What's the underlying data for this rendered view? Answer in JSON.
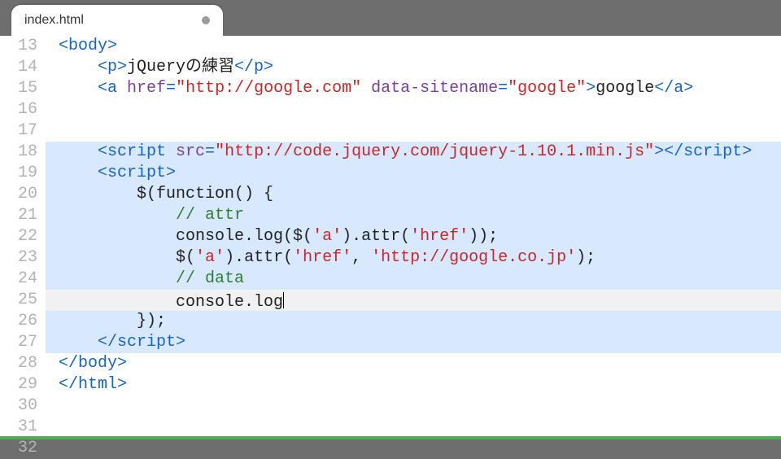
{
  "tab": {
    "filename": "index.html",
    "dirty": true
  },
  "gutter_start": 13,
  "gutter_end": 32,
  "current_line": 25,
  "selection_lines": [
    18,
    19,
    20,
    21,
    22,
    23,
    24,
    25,
    26,
    27
  ],
  "code_lines": {
    "13": [
      {
        "cls": "tag",
        "t": "<body>"
      }
    ],
    "14": [
      {
        "cls": "pun",
        "t": "    "
      },
      {
        "cls": "tag",
        "t": "<p>"
      },
      {
        "cls": "txt",
        "t": "jQueryの練習"
      },
      {
        "cls": "tag",
        "t": "</p>"
      }
    ],
    "15": [
      {
        "cls": "pun",
        "t": "    "
      },
      {
        "cls": "tag",
        "t": "<a "
      },
      {
        "cls": "attr",
        "t": "href"
      },
      {
        "cls": "tag",
        "t": "="
      },
      {
        "cls": "str",
        "t": "\"http://google.com\""
      },
      {
        "cls": "tag",
        "t": " "
      },
      {
        "cls": "attr",
        "t": "data-sitename"
      },
      {
        "cls": "tag",
        "t": "="
      },
      {
        "cls": "str",
        "t": "\"google\""
      },
      {
        "cls": "tag",
        "t": ">"
      },
      {
        "cls": "txt",
        "t": "google"
      },
      {
        "cls": "tag",
        "t": "</a>"
      }
    ],
    "16": [
      {
        "cls": "pun",
        "t": ""
      }
    ],
    "17": [
      {
        "cls": "pun",
        "t": ""
      }
    ],
    "18": [
      {
        "cls": "pun",
        "t": "    "
      },
      {
        "cls": "tag",
        "t": "<script "
      },
      {
        "cls": "attr",
        "t": "src"
      },
      {
        "cls": "tag",
        "t": "="
      },
      {
        "cls": "str",
        "t": "\"http://code.jquery.com/jquery-1.10.1.min.js\""
      },
      {
        "cls": "tag",
        "t": ">"
      },
      {
        "cls": "tag",
        "t": "</script>"
      }
    ],
    "19": [
      {
        "cls": "pun",
        "t": "    "
      },
      {
        "cls": "tag",
        "t": "<script>"
      }
    ],
    "20": [
      {
        "cls": "pun",
        "t": "        "
      },
      {
        "cls": "txt",
        "t": "$(function() {"
      }
    ],
    "21": [
      {
        "cls": "pun",
        "t": "            "
      },
      {
        "cls": "com",
        "t": "// attr"
      }
    ],
    "22": [
      {
        "cls": "pun",
        "t": "            "
      },
      {
        "cls": "txt",
        "t": "console.log($("
      },
      {
        "cls": "str",
        "t": "'a'"
      },
      {
        "cls": "txt",
        "t": ").attr("
      },
      {
        "cls": "str",
        "t": "'href'"
      },
      {
        "cls": "txt",
        "t": "));"
      }
    ],
    "23": [
      {
        "cls": "pun",
        "t": "            "
      },
      {
        "cls": "txt",
        "t": "$("
      },
      {
        "cls": "str",
        "t": "'a'"
      },
      {
        "cls": "txt",
        "t": ").attr("
      },
      {
        "cls": "str",
        "t": "'href'"
      },
      {
        "cls": "txt",
        "t": ", "
      },
      {
        "cls": "str",
        "t": "'http://google.co.jp'"
      },
      {
        "cls": "txt",
        "t": ");"
      }
    ],
    "24": [
      {
        "cls": "pun",
        "t": "            "
      },
      {
        "cls": "com",
        "t": "// data"
      }
    ],
    "25": [
      {
        "cls": "pun",
        "t": "            "
      },
      {
        "cls": "txt",
        "t": "console.log"
      }
    ],
    "26": [
      {
        "cls": "pun",
        "t": "        "
      },
      {
        "cls": "txt",
        "t": "});"
      }
    ],
    "27": [
      {
        "cls": "pun",
        "t": "    "
      },
      {
        "cls": "tag",
        "t": "</script>"
      }
    ],
    "28": [
      {
        "cls": "tag",
        "t": "</body>"
      }
    ],
    "29": [
      {
        "cls": "tag",
        "t": "</html>"
      }
    ],
    "30": [
      {
        "cls": "pun",
        "t": ""
      }
    ],
    "31": [
      {
        "cls": "pun",
        "t": ""
      }
    ],
    "32": [
      {
        "cls": "pun",
        "t": ""
      }
    ]
  }
}
